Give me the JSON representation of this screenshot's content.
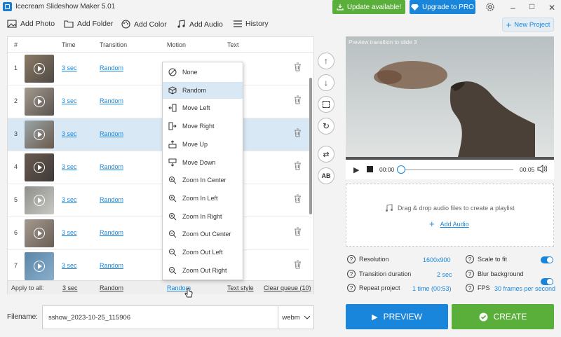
{
  "app": {
    "title": "Icecream Slideshow Maker 5.01"
  },
  "header": {
    "update_label": "Update available!",
    "pro_label": "Upgrade to PRO"
  },
  "toolbar": {
    "add_photo": "Add Photo",
    "add_folder": "Add Folder",
    "add_color": "Add Color",
    "add_audio": "Add Audio",
    "history": "History",
    "new_project": "New Project"
  },
  "table": {
    "headers": {
      "num": "#",
      "time": "Time",
      "transition": "Transition",
      "motion": "Motion",
      "text": "Text"
    },
    "rows": [
      {
        "num": "1",
        "time": "3 sec",
        "transition": "Random"
      },
      {
        "num": "2",
        "time": "3 sec",
        "transition": "Random"
      },
      {
        "num": "3",
        "time": "3 sec",
        "transition": "Random"
      },
      {
        "num": "4",
        "time": "3 sec",
        "transition": "Random"
      },
      {
        "num": "5",
        "time": "3 sec",
        "transition": "Random"
      },
      {
        "num": "6",
        "time": "3 sec",
        "transition": "Random"
      },
      {
        "num": "7",
        "time": "3 sec",
        "transition": "Random"
      }
    ],
    "footer": {
      "apply_all": "Apply to all:",
      "time": "3 sec",
      "transition": "Random",
      "motion": "Random",
      "text_style": "Text style",
      "clear": "Clear queue (10)"
    }
  },
  "motion_menu": {
    "items": [
      "None",
      "Random",
      "Move Left",
      "Move Right",
      "Move Up",
      "Move Down",
      "Zoom In Center",
      "Zoom In Left",
      "Zoom In Right",
      "Zoom Out Center",
      "Zoom Out Left",
      "Zoom Out Right"
    ],
    "selected": "Random"
  },
  "preview": {
    "title": "Preview transition to slide 3",
    "time_current": "00:00",
    "time_total": "00:05",
    "progress": 0
  },
  "audio": {
    "drop_text": "Drag & drop audio files to create a playlist",
    "add_audio": "Add Audio"
  },
  "settings": {
    "resolution_label": "Resolution",
    "resolution_value": "1600x900",
    "transition_label": "Transition duration",
    "transition_value": "2 sec",
    "repeat_label": "Repeat project",
    "repeat_value": "1 time (00:53)",
    "scale_label": "Scale to fit",
    "scale_on": true,
    "blur_label": "Blur background",
    "blur_on": true,
    "fps_label": "FPS",
    "fps_value": "30 frames per second"
  },
  "bottom": {
    "filename_label": "Filename:",
    "filename_value": "sshow_2023-10-25_115906",
    "format": "webm",
    "preview_label": "PREVIEW",
    "create_label": "CREATE"
  },
  "colors": {
    "accent": "#1a86db",
    "green": "#5aae3a",
    "selected_row": "#d9e8f5"
  }
}
